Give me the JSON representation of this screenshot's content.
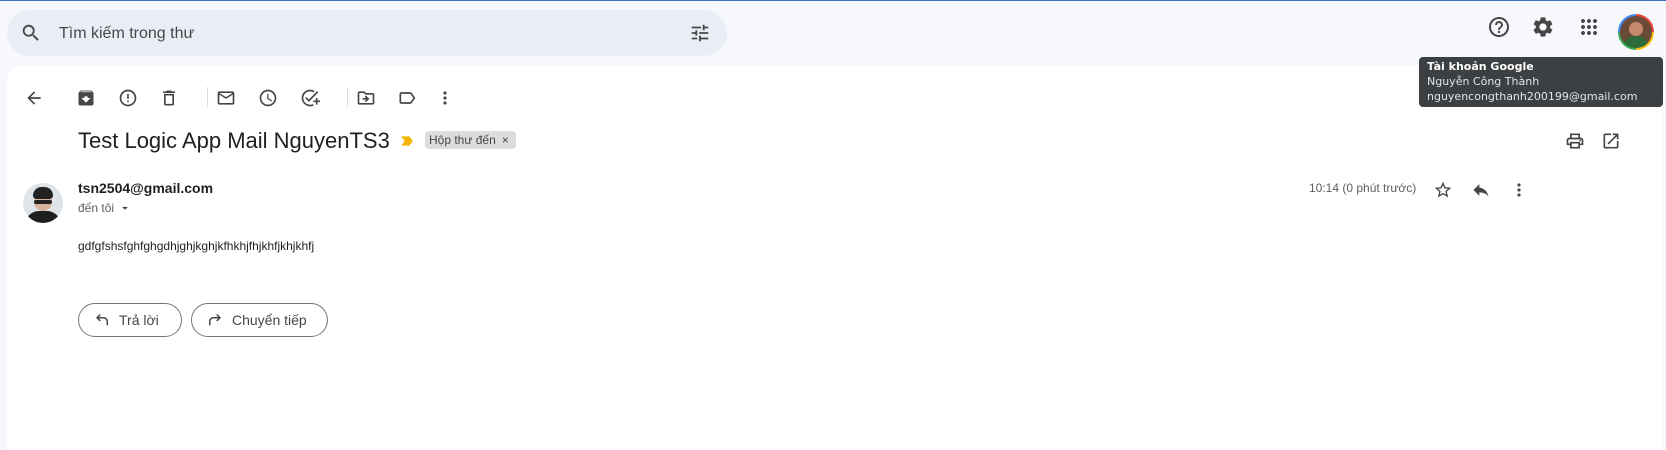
{
  "search": {
    "placeholder": "Tìm kiếm trong thư"
  },
  "message": {
    "subject": "Test Logic App Mail NguyenTS3",
    "label": "Hộp thư đến",
    "label_remove": "×",
    "sender_email": "tsn2504@gmail.com",
    "recipient_summary": "đến tôi",
    "time": "10:14 (0 phút trước)",
    "body": "gdfgfshsfghfghgdhjghjkghjkfhkhjfhjkhfjkhjkhfj"
  },
  "actions": {
    "reply": "Trả lời",
    "forward": "Chuyển tiếp"
  },
  "tooltip": {
    "title": "Tài khoản Google",
    "name": "Nguyễn Công Thành",
    "email": "nguyencongthanh200199@gmail.com"
  },
  "colors": {
    "accent_border": "#3b6fc4",
    "important_marker": "#f4b400",
    "tooltip_bg": "#3c4043"
  }
}
